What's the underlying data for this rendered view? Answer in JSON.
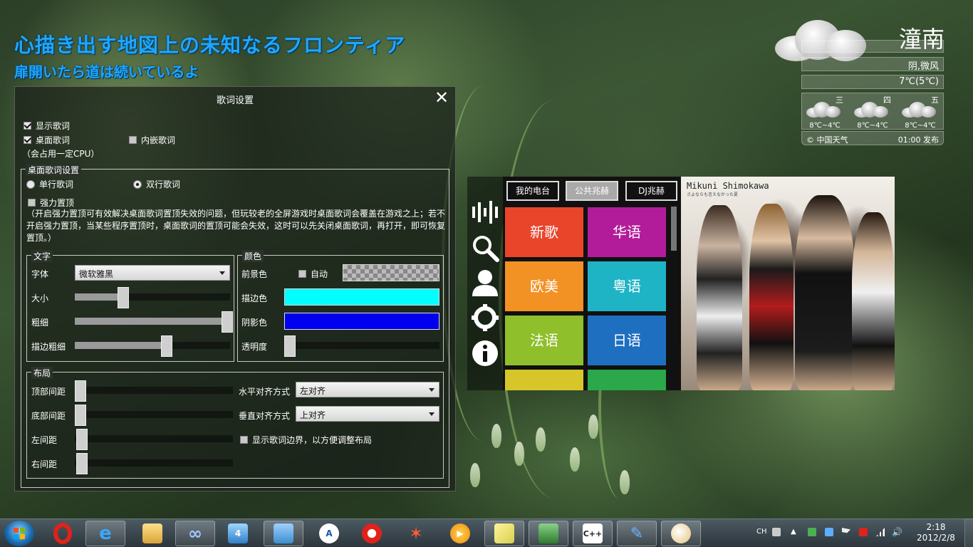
{
  "desktop_lyrics": {
    "line1": "心描き出す地図上の未知なるフロンティア",
    "line2": "扉開いたら道は続いているよ"
  },
  "lyric_settings": {
    "title": "歌词设置",
    "show_lyrics": "显示歌词",
    "desktop_lyrics": "桌面歌词",
    "embedded_lyrics": "内嵌歌词",
    "cpu_note": "（会占用一定CPU）",
    "desktop_group": "桌面歌词设置",
    "single_line": "单行歌词",
    "double_line": "双行歌词",
    "force_top": "强力置顶",
    "force_top_desc": "（开启强力置顶可有效解决桌面歌词置顶失效的问题，但玩较老的全屏游戏时桌面歌词会覆盖在游戏之上；若不开启强力置顶，当某些程序置顶时，桌面歌词的置顶可能会失效，这时可以先关闭桌面歌词，再打开，即可恢复置顶。）",
    "text_group": "文字",
    "font_label": "字体",
    "font_value": "微软雅黑",
    "size_label": "大小",
    "size_value": 0.31,
    "weight_label": "粗细",
    "weight_value": 0.98,
    "stroke_label": "描边粗细",
    "stroke_value": 0.59,
    "color_group": "颜色",
    "fg_label": "前景色",
    "auto_label": "自动",
    "stroke_color_label": "描边色",
    "stroke_color": "#00ffff",
    "shadow_color_label": "阴影色",
    "shadow_color": "#0000ee",
    "opacity_label": "透明度",
    "opacity_value": 0.02,
    "layout_group": "布局",
    "top_margin_label": "顶部间距",
    "bottom_margin_label": "底部间距",
    "left_margin_label": "左间距",
    "right_margin_label": "右间距",
    "h_align_label": "水平对齐方式",
    "h_align_value": "左对齐",
    "v_align_label": "垂直对齐方式",
    "v_align_value": "上对齐",
    "show_border_label": "显示歌词边界，以方便调整布局"
  },
  "weather": {
    "city": "潼南",
    "condition": "阴,微风",
    "temp": "7℃(5℃)",
    "forecast": [
      {
        "day": "三",
        "range": "8℃~4℃"
      },
      {
        "day": "四",
        "range": "8℃~4℃"
      },
      {
        "day": "五",
        "range": "8℃~4℃"
      }
    ],
    "source": "© 中国天气",
    "published": "01:00 发布"
  },
  "player": {
    "tabs": [
      "我的电台",
      "公共兆赫",
      "DJ兆赫"
    ],
    "tiles": [
      {
        "label": "新歌",
        "color": "#e8452b"
      },
      {
        "label": "华语",
        "color": "#b21c9a"
      },
      {
        "label": "欧美",
        "color": "#f29124"
      },
      {
        "label": "粤语",
        "color": "#1fb3c6"
      },
      {
        "label": "法语",
        "color": "#8fbf2b"
      },
      {
        "label": "日语",
        "color": "#1f6fc0"
      }
    ],
    "album_artist": "Mikuni Shimokawa",
    "album_subtitle": "さよならも言えなかった夏"
  },
  "taskbar": {
    "lang": "CH",
    "time": "2:18",
    "date": "2012/2/8"
  }
}
